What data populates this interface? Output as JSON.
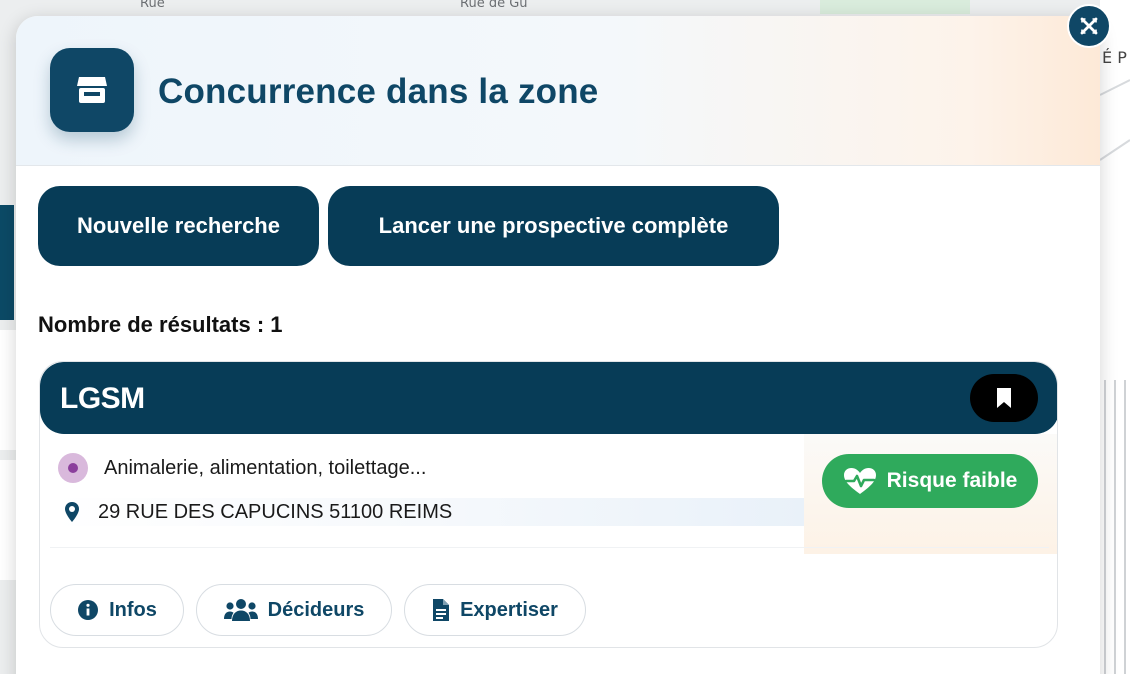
{
  "map": {
    "labels": [
      "Rue de Gu",
      "Rue",
      "É P"
    ]
  },
  "panel": {
    "title": "Concurrence dans la zone",
    "header_icon": "store-icon",
    "close_icon": "close-icon"
  },
  "actions": {
    "new_search": "Nouvelle recherche",
    "full_prospect": "Lancer une prospective complète"
  },
  "results": {
    "count_label": "Nombre de résultats : 1",
    "items": [
      {
        "name": "LGSM",
        "activity": "Animalerie, alimentation, toilettage...",
        "address": "29 RUE DES CAPUCINS 51100 REIMS",
        "risk_label": "Risque faible",
        "bookmark_icon": "bookmark-icon",
        "buttons": {
          "infos": "Infos",
          "decideurs": "Décideurs",
          "expertiser": "Expertiser"
        }
      }
    ]
  },
  "colors": {
    "primary": "#0f4766",
    "dark": "#073c57",
    "risk_low": "#2faa5c",
    "activity": "#8b3f9c"
  }
}
